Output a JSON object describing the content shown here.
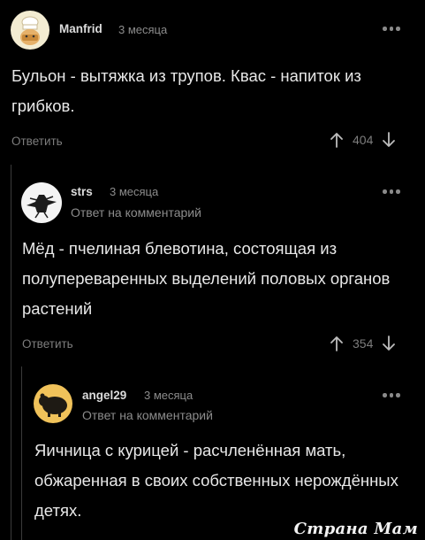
{
  "comments": [
    {
      "author": "Manfrid",
      "time": "3 месяца",
      "reply_to": "",
      "text": "Бульон - вытяжка из трупов. Квас - напиток из грибков.",
      "reply_label": "Ответить",
      "votes": "404"
    },
    {
      "author": "strs",
      "time": "3 месяца",
      "reply_to": "Ответ на комментарий",
      "text": "Мёд - пчелиная блевотина, состоящая из полупереваренных выделений половых органов растений",
      "reply_label": "Ответить",
      "votes": "354"
    },
    {
      "author": "angel29",
      "time": "3 месяца",
      "reply_to": "Ответ на комментарий",
      "text": "Яичница с курицей - расчленённая мать, обжаренная в своих собственных нерождённых детях.",
      "reply_label": "",
      "votes": ""
    }
  ],
  "watermark": "Страна Мам",
  "icons": {
    "more": "more-dots-icon",
    "upvote": "arrow-up-icon",
    "downvote": "arrow-down-icon"
  },
  "colors": {
    "background": "#000000",
    "text": "#e8e8e8",
    "muted": "#8c8c8c",
    "thread_line": "#3a3a3a"
  }
}
